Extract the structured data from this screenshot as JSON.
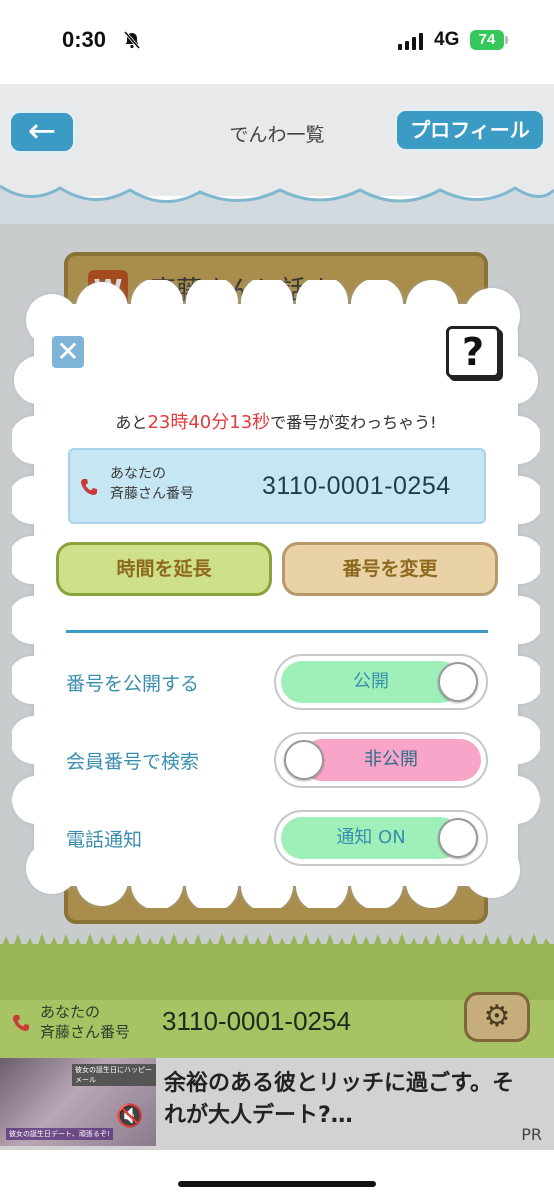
{
  "status_bar": {
    "time": "0:30",
    "network": "4G",
    "battery": "74"
  },
  "header": {
    "back_label": "←",
    "title": "でんわ一覧",
    "profile_label": "プロフィール"
  },
  "background": {
    "card_icon": "W",
    "card_title": "斉藤さんと話す"
  },
  "modal": {
    "close_label": "✕",
    "help_label": "?",
    "countdown": {
      "prefix": "あと",
      "hours": "23",
      "hours_unit": "時",
      "minutes": "40",
      "minutes_unit": "分",
      "seconds": "13",
      "seconds_unit": "秒",
      "suffix": "で番号が変わっちゃう!"
    },
    "number_label_line1": "あなたの",
    "number_label_line2": "斉藤さん番号",
    "number": "3110-0001-0254",
    "extend_button": "時間を延長",
    "change_button": "番号を変更",
    "settings": [
      {
        "label": "番号を公開する",
        "state": "公開",
        "on": true
      },
      {
        "label": "会員番号で検索",
        "state": "非公開",
        "on": false
      },
      {
        "label": "電話通知",
        "state": "通知 ON",
        "on": true
      }
    ]
  },
  "bottom_bar": {
    "label_line1": "あなたの",
    "label_line2": "斉藤さん番号",
    "number": "3110-0001-0254",
    "settings_icon": "gear-icon"
  },
  "ad": {
    "text": "余裕のある彼とリッチに過ごす。それが大人デート?…",
    "pr": "PR",
    "thumb_tag": "彼女の誕生日にハッピーメール",
    "thumb_caption": "彼女の誕生日デート、頑張るぞ!"
  },
  "colors": {
    "accent": "#3c9bc4",
    "countdown_red": "#e43c3c",
    "toggle_on": "#9ef0b8",
    "toggle_off": "#f9a5c9"
  }
}
